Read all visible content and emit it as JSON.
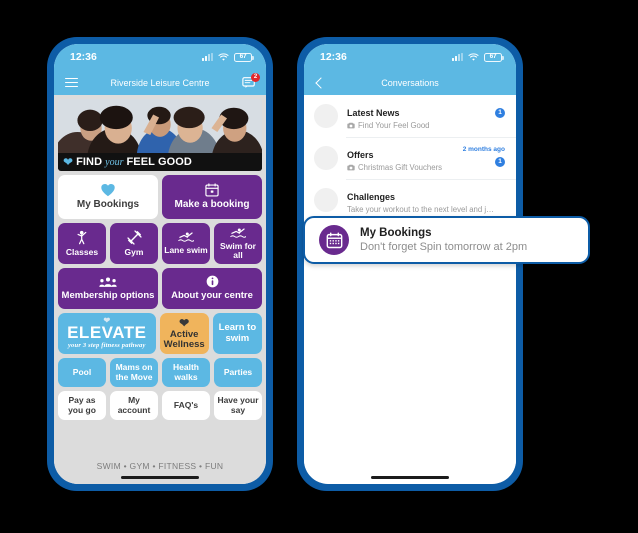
{
  "left_phone": {
    "status_bar": {
      "time": "12:36",
      "battery_level": "67",
      "signal_icon": "signal-bars-icon",
      "wifi_icon": "wifi-icon",
      "battery_icon": "battery-icon"
    },
    "header": {
      "menu_icon": "hamburger-menu-icon",
      "title": "Riverside Leisure Centre",
      "messages_icon": "chat-bubble-icon",
      "messages_badge": "2"
    },
    "hero": {
      "heart_icon": "heart-icon",
      "text_1": "FIND",
      "text_2": "your",
      "text_3": "FEEL GOOD"
    },
    "tiles": [
      {
        "label": "My Bookings",
        "style": "white",
        "icon": "heart-icon"
      },
      {
        "label": "Make a booking",
        "style": "purple",
        "icon": "calendar-icon"
      },
      {
        "label": "Classes",
        "style": "purple",
        "icon": "person-exercising-icon"
      },
      {
        "label": "Gym",
        "style": "purple",
        "icon": "dumbbell-icon"
      },
      {
        "label": "Lane swim",
        "style": "purple",
        "icon": "swimmer-icon"
      },
      {
        "label": "Swim for all",
        "style": "purple",
        "icon": "swimmer-icon"
      },
      {
        "label": "Membership options",
        "style": "purple",
        "icon": "people-group-icon"
      },
      {
        "label": "About your centre",
        "style": "purple",
        "icon": "info-icon"
      },
      {
        "label": "Active Wellness",
        "style": "amber",
        "icon": "heart-icon"
      },
      {
        "label": "Learn to swim",
        "style": "blue",
        "icon": "none"
      },
      {
        "label": "Pool",
        "style": "blue",
        "icon": "none"
      },
      {
        "label": "Mams on the Move",
        "style": "blue",
        "icon": "none"
      },
      {
        "label": "Health walks",
        "style": "blue",
        "icon": "none"
      },
      {
        "label": "Parties",
        "style": "blue",
        "icon": "none"
      },
      {
        "label": "Pay as you go",
        "style": "white",
        "icon": "none"
      },
      {
        "label": "My account",
        "style": "white",
        "icon": "none"
      },
      {
        "label": "FAQ's",
        "style": "white",
        "icon": "none"
      },
      {
        "label": "Have your say",
        "style": "white",
        "icon": "none"
      }
    ],
    "elevate_tile": {
      "heart_icon": "heart-icon",
      "word": "ELEVATE",
      "tagline": "your 3 step fitness pathway"
    },
    "footer_tagline": "SWIM • GYM • FITNESS • FUN"
  },
  "right_phone": {
    "status_bar": {
      "time": "12:36",
      "battery_level": "67"
    },
    "header": {
      "back_icon": "back-chevron-icon",
      "title": "Conversations"
    },
    "conversations": [
      {
        "name": "Latest News",
        "preview": "Find Your Feel Good",
        "attachment_icon": "camera-icon",
        "time": "",
        "unread": "1"
      },
      {
        "name": "Offers",
        "preview": "Christmas Gift Vouchers",
        "attachment_icon": "camera-icon",
        "time": "2 months ago",
        "unread": "1"
      },
      {
        "name": "Challenges",
        "preview": "Take your workout to the next level and j…",
        "attachment_icon": "none",
        "time": "",
        "unread": ""
      }
    ]
  },
  "highlighted_card": {
    "avatar_icon": "calendar-icon",
    "title": "My Bookings",
    "message": "Don't forget Spin tomorrow at 2pm"
  },
  "colors": {
    "phone_frame": "#0d5ca6",
    "sky_blue": "#5cb8e3",
    "purple": "#692a8e",
    "amber": "#f0b45c",
    "badge_red": "#e3262b",
    "badge_blue": "#2f7fe0",
    "home_background": "#dcdcdc"
  }
}
